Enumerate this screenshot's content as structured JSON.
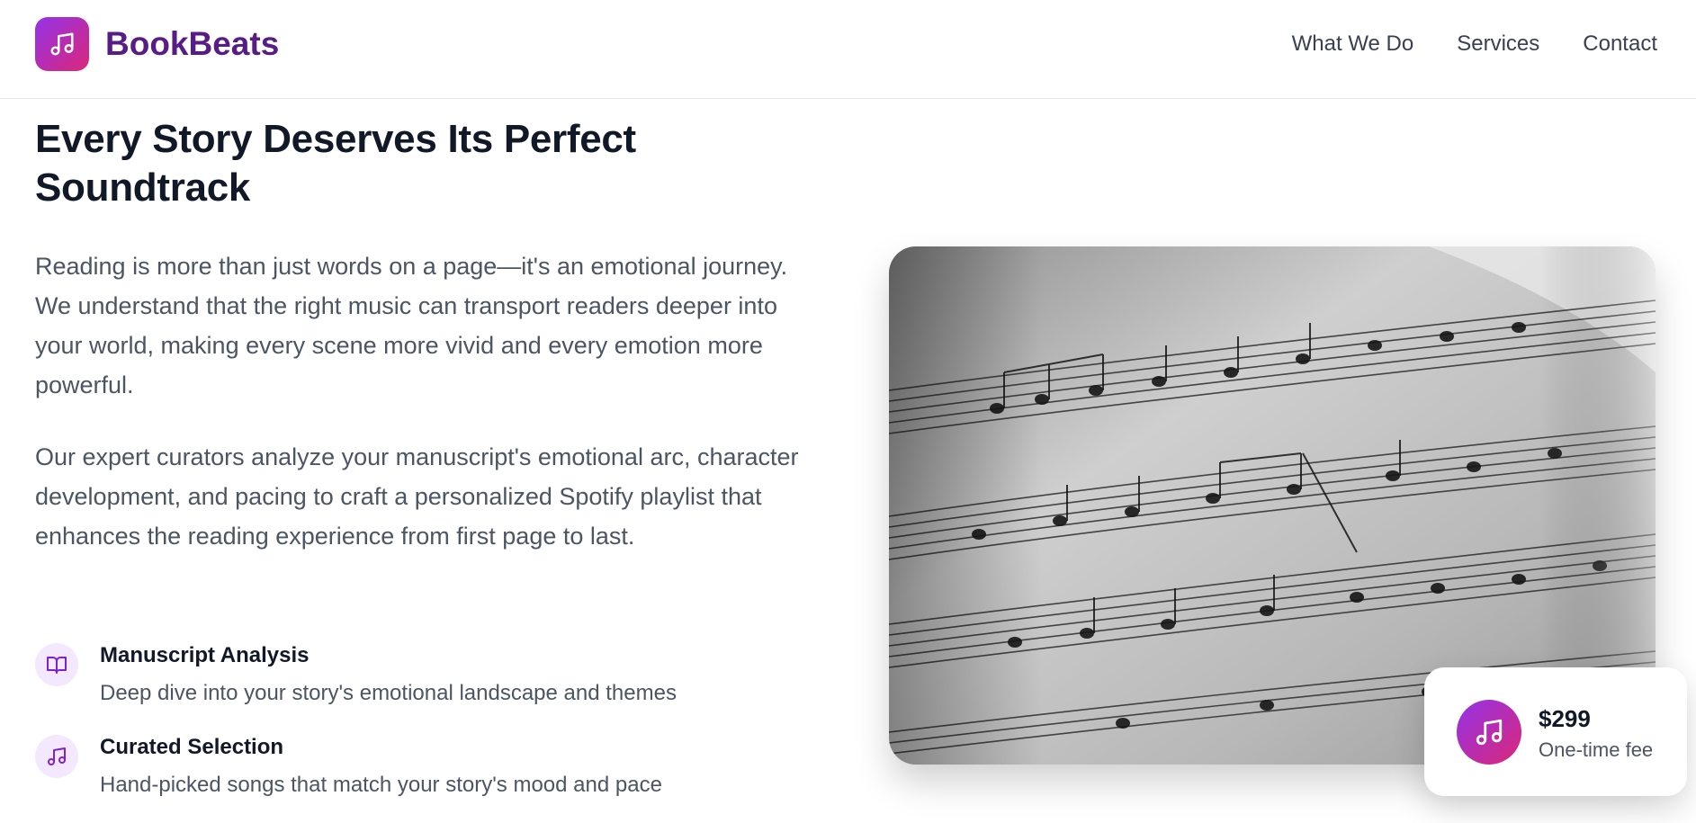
{
  "brand": {
    "name": "BookBeats",
    "logo_icon": "music-note-icon"
  },
  "nav": {
    "items": [
      "What We Do",
      "Services",
      "Contact"
    ]
  },
  "hero": {
    "title": "Every Story Deserves Its Perfect Soundtrack",
    "paragraphs": [
      "Reading is more than just words on a page—it's an emotional journey. We understand that the right music can transport readers deeper into your world, making every scene more vivid and every emotion more powerful.",
      "Our expert curators analyze your manuscript's emotional arc, character development, and pacing to craft a personalized Spotify playlist that enhances the reading experience from first page to last."
    ]
  },
  "features": [
    {
      "icon": "book-open-icon",
      "title": "Manuscript Analysis",
      "description": "Deep dive into your story's emotional landscape and themes"
    },
    {
      "icon": "music-note-icon",
      "title": "Curated Selection",
      "description": "Hand-picked songs that match your story's mood and pace"
    }
  ],
  "image": {
    "subject": "sheet-music-photo"
  },
  "price": {
    "amount": "$299",
    "label": "One-time fee",
    "icon": "music-note-icon"
  },
  "colors": {
    "brand_purple": "#581c87",
    "gradient_start": "#9333ea",
    "gradient_end": "#db2777",
    "icon_bg": "#f3e8ff"
  }
}
